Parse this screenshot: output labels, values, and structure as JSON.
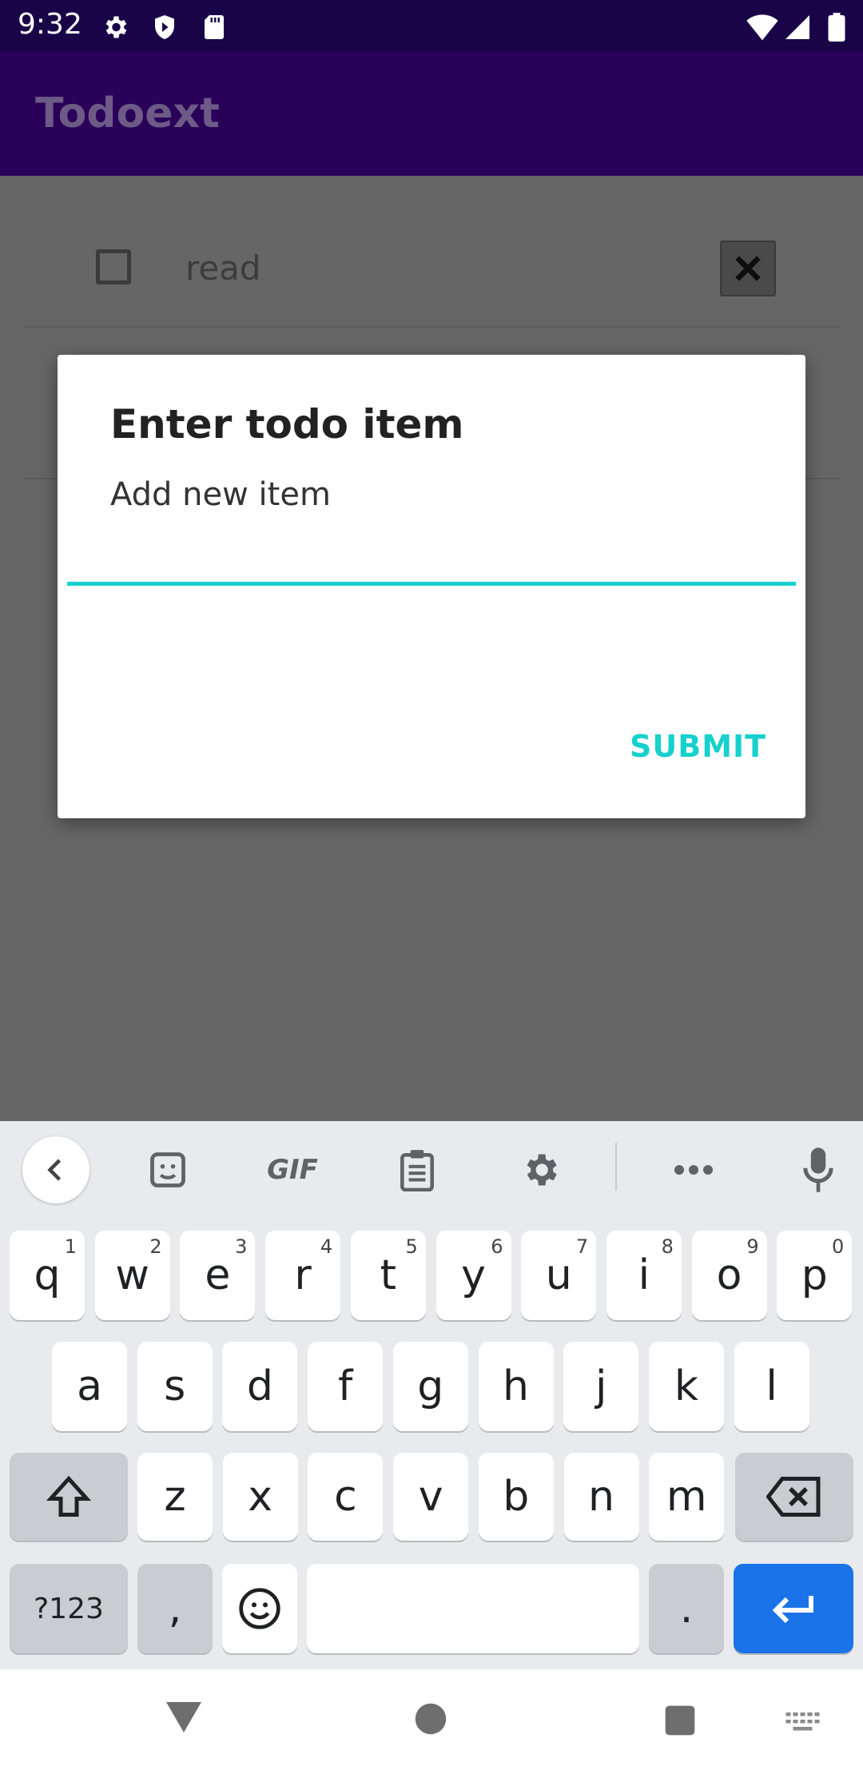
{
  "status_bar": {
    "time": "9:32",
    "left_icons": [
      "gear-icon",
      "shield-icon",
      "sd-card-icon"
    ],
    "right_icons": [
      "wifi-icon",
      "signal-icon",
      "battery-icon"
    ]
  },
  "app_bar": {
    "title": "Todoext"
  },
  "list": {
    "items": [
      {
        "text": "read",
        "checked": false
      }
    ]
  },
  "dialog": {
    "title": "Enter todo item",
    "message": "Add new item",
    "input_value": "",
    "submit_label": "SUBMIT",
    "accent_color": "#16d1cd"
  },
  "keyboard": {
    "toolbar": [
      "back-icon",
      "sticker-icon",
      "gif-icon",
      "clipboard-icon",
      "settings-icon",
      "more-icon",
      "mic-icon"
    ],
    "gif_label": "GIF",
    "rows": [
      [
        {
          "k": "q",
          "h": "1"
        },
        {
          "k": "w",
          "h": "2"
        },
        {
          "k": "e",
          "h": "3"
        },
        {
          "k": "r",
          "h": "4"
        },
        {
          "k": "t",
          "h": "5"
        },
        {
          "k": "y",
          "h": "6"
        },
        {
          "k": "u",
          "h": "7"
        },
        {
          "k": "i",
          "h": "8"
        },
        {
          "k": "o",
          "h": "9"
        },
        {
          "k": "p",
          "h": "0"
        }
      ],
      [
        {
          "k": "a"
        },
        {
          "k": "s"
        },
        {
          "k": "d"
        },
        {
          "k": "f"
        },
        {
          "k": "g"
        },
        {
          "k": "h"
        },
        {
          "k": "j"
        },
        {
          "k": "k"
        },
        {
          "k": "l"
        }
      ],
      [
        {
          "k": "z"
        },
        {
          "k": "x"
        },
        {
          "k": "c"
        },
        {
          "k": "v"
        },
        {
          "k": "b"
        },
        {
          "k": "n"
        },
        {
          "k": "m"
        }
      ]
    ],
    "symbols_label": "?123",
    "comma_label": ",",
    "period_label": ".",
    "enter_color": "#1a73e8"
  },
  "nav_bar": {
    "icons": [
      "back-triangle-icon",
      "home-circle-icon",
      "recents-square-icon",
      "keyboard-switch-icon"
    ]
  }
}
